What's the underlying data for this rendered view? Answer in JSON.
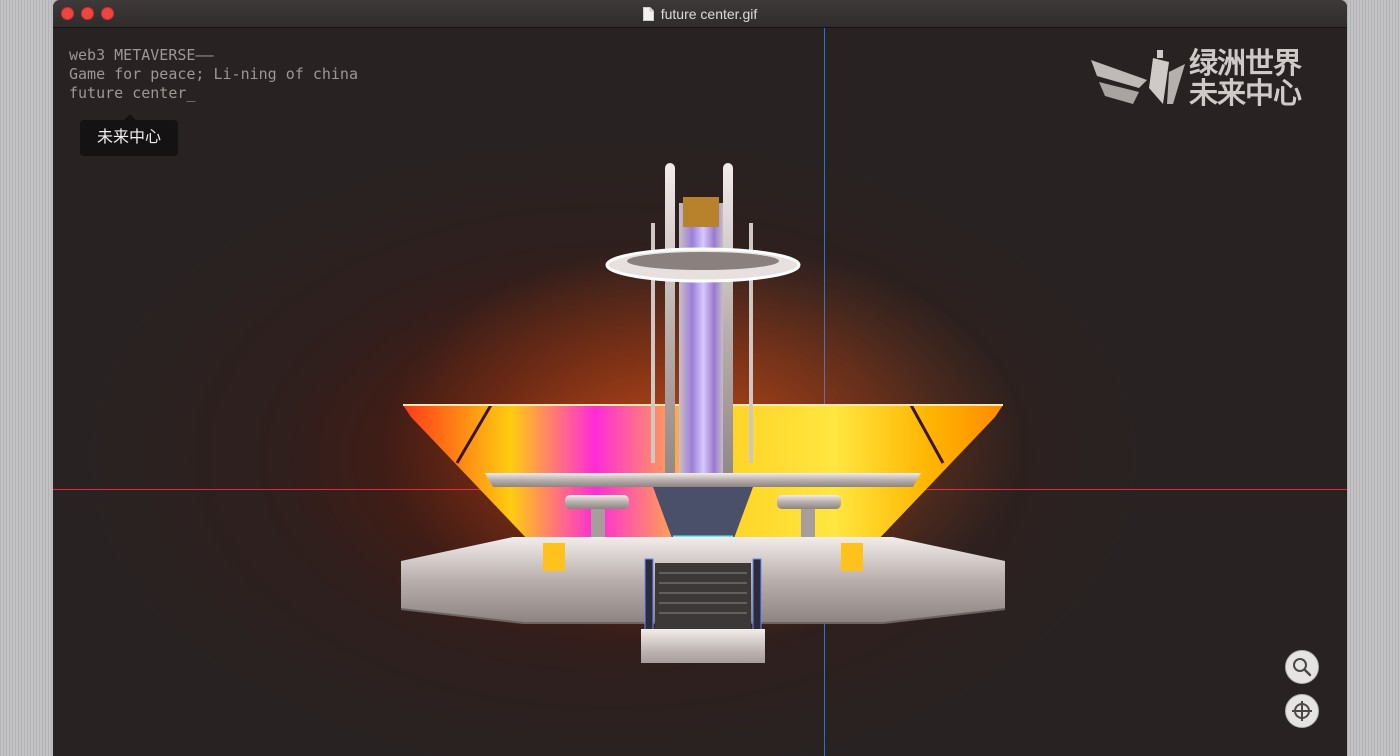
{
  "window": {
    "title": "future center.gif",
    "traffic_lights": [
      "close-dot",
      "minimize-dot",
      "zoom-dot"
    ]
  },
  "console": {
    "lines": [
      "web3 METAVERSE——",
      "Game for peace; Li-ning of china",
      "future center_"
    ]
  },
  "tooltip": {
    "text": "未来中心"
  },
  "logo": {
    "line1": "绿洲世界",
    "line2": "未来中心"
  },
  "controls": {
    "zoom_icon": "magnifier-icon",
    "recenter_icon": "crosshair-icon"
  },
  "colors": {
    "window_bg": "#262221",
    "axis_x": "#d92b43",
    "axis_y": "#2d6fd9",
    "traffic_red": "#f0443e"
  }
}
